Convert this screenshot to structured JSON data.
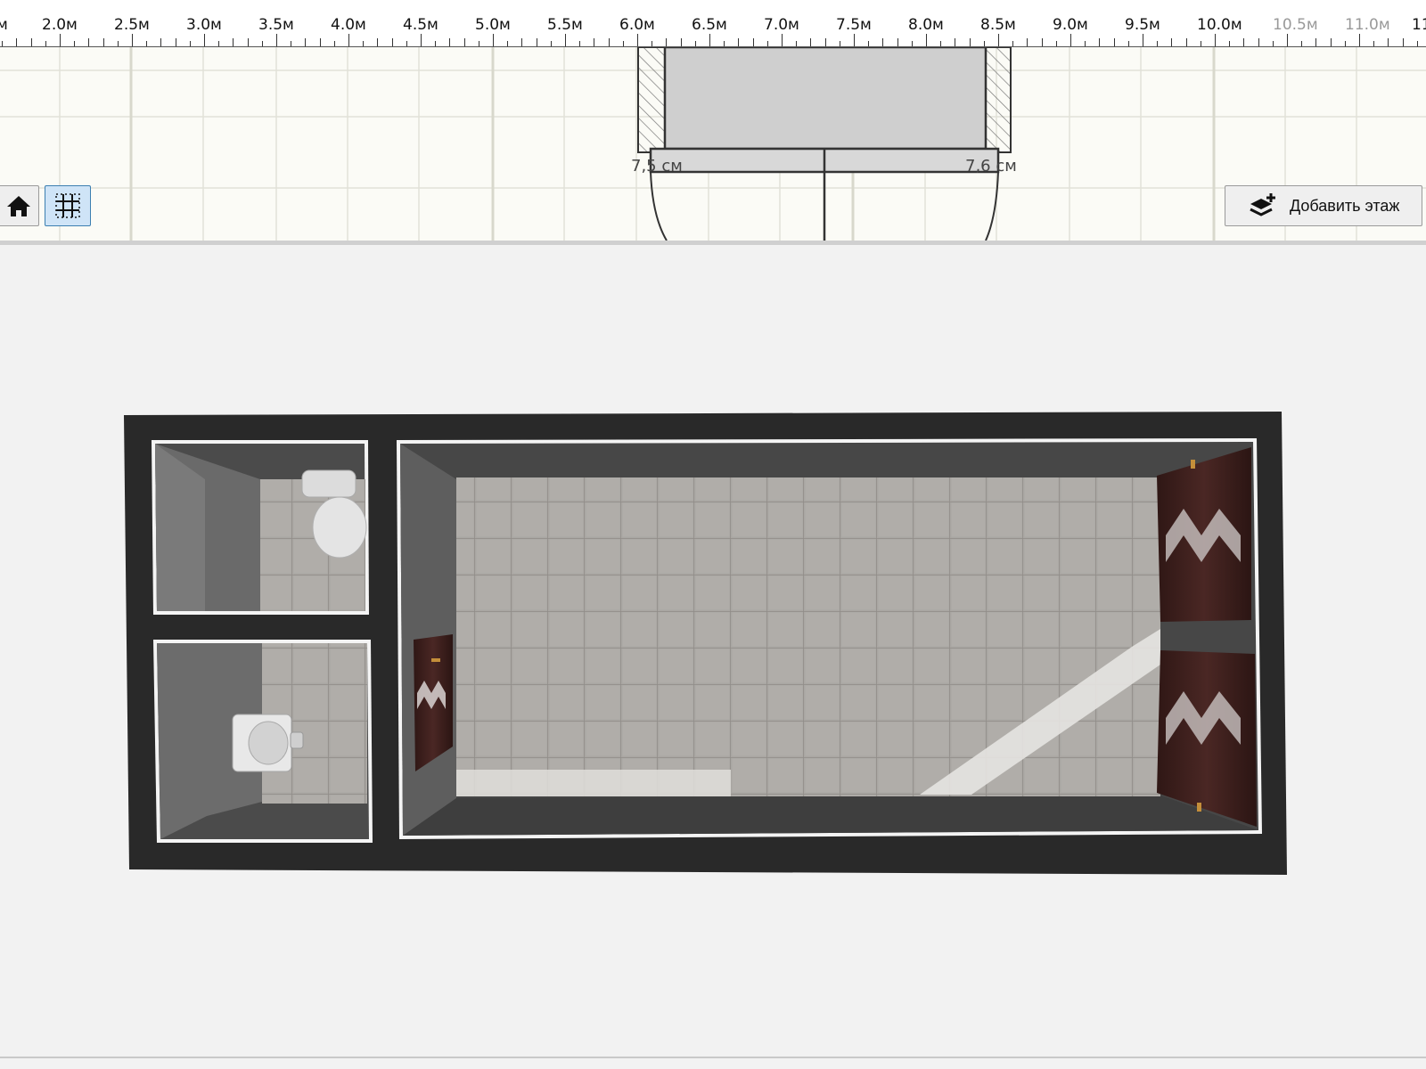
{
  "ruler": {
    "labels": [
      "2.0м",
      "2.5м",
      "3.0м",
      "3.5м",
      "4.0м",
      "4.5м",
      "5.0м",
      "5.5м",
      "6.0м",
      "6.5м",
      "7.0м",
      "7.5м",
      "8.0м",
      "8.5м",
      "9.0м",
      "9.5м",
      "10.0м",
      "10.5м",
      "11.0м"
    ],
    "edge_left": "м",
    "edge_right": "11"
  },
  "plan": {
    "dim_left": "7,5 см",
    "dim_right": "7,6 см"
  },
  "toolbar": {
    "home_icon": "home-icon",
    "grid_icon": "grid-icon",
    "add_floor_label": "Добавить этаж",
    "add_floor_icon": "add-layer-icon"
  },
  "colors": {
    "selected_button": "#cfe4f7",
    "wall": "#2a2a2a",
    "floor_tile": "#a8a5a1",
    "door": "#3a1f1c"
  }
}
